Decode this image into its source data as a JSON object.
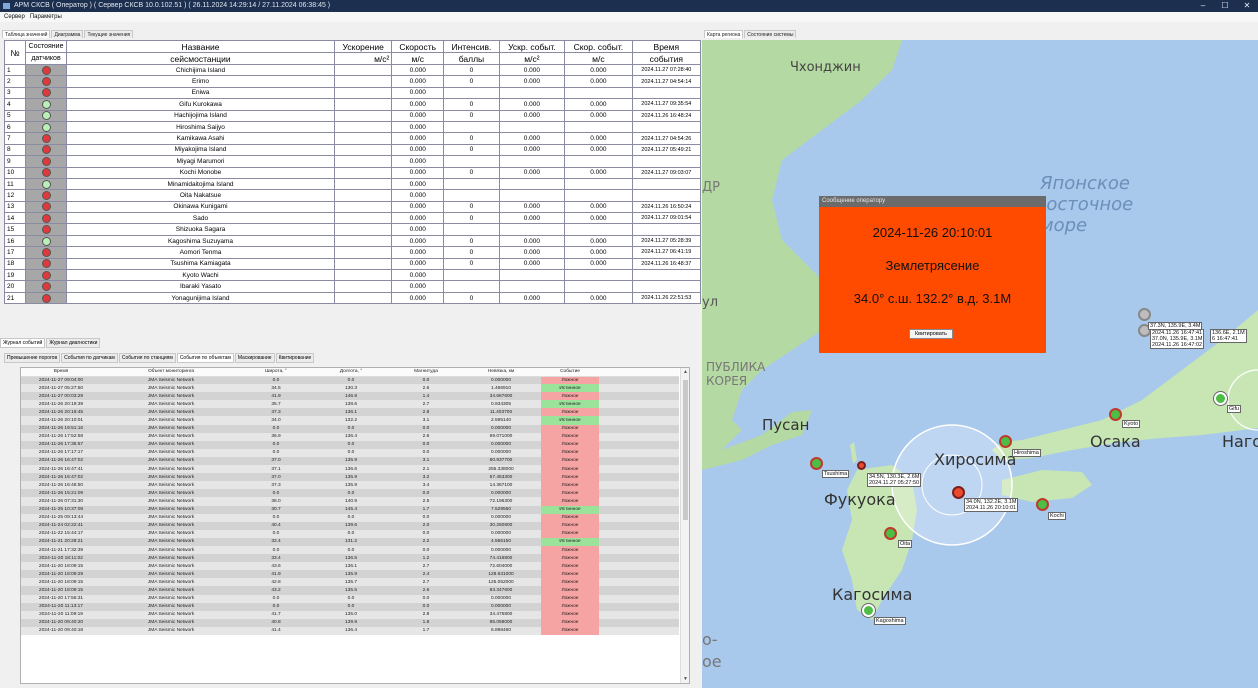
{
  "window": {
    "title": "АРМ СКСВ ( Оператор ) ( Сервер СКСВ 10.0.102.51 ) ( 26.11.2024 14:29:14 / 27.11.2024 06:38:45 )",
    "minimize": "–",
    "maximize": "☐",
    "close": "✕"
  },
  "menu": {
    "items": [
      "Сервер",
      "Параметры"
    ]
  },
  "left_tabs": [
    "Таблица значений",
    "Диаграмма",
    "Текущие значения"
  ],
  "stations_table": {
    "headers": {
      "num": "№",
      "state": [
        "Состояние",
        "датчиков"
      ],
      "name": [
        "Название",
        "сейсмостанции"
      ],
      "accel": [
        "Ускорение",
        "м/с²"
      ],
      "speed": [
        "Скорость",
        "м/с"
      ],
      "intensity": [
        "Интенсив.",
        "баллы"
      ],
      "ev_accel": [
        "Ускр. событ.",
        "м/с²"
      ],
      "ev_speed": [
        "Скор. событ.",
        "м/с"
      ],
      "ev_time": [
        "Время",
        "события"
      ]
    },
    "rows": [
      {
        "n": "1",
        "state": "red",
        "name": "Chichijima Island",
        "accel": "",
        "speed": "0.000",
        "int": "0",
        "ea": "0.000",
        "es": "0.000",
        "t": "2024.11.27 07:28:40"
      },
      {
        "n": "2",
        "state": "red",
        "name": "Erimo",
        "accel": "",
        "speed": "0.000",
        "int": "0",
        "ea": "0.000",
        "es": "0.000",
        "t": "2024.11.27 04:54:14"
      },
      {
        "n": "3",
        "state": "red",
        "name": "Eniwa",
        "accel": "",
        "speed": "0.000",
        "int": "",
        "ea": "",
        "es": "",
        "t": ""
      },
      {
        "n": "4",
        "state": "green",
        "name": "Gifu Kurokawa",
        "accel": "",
        "speed": "0.000",
        "int": "0",
        "ea": "0.000",
        "es": "0.000",
        "t": "2024.11.27 09:35:54"
      },
      {
        "n": "5",
        "state": "green",
        "name": "Hachijojima Island",
        "accel": "",
        "speed": "0.000",
        "int": "0",
        "ea": "0.000",
        "es": "0.000",
        "t": "2024.11.26 16:48:24"
      },
      {
        "n": "6",
        "state": "green",
        "name": "Hiroshima Saijyo",
        "accel": "",
        "speed": "0.000",
        "int": "",
        "ea": "",
        "es": "",
        "t": ""
      },
      {
        "n": "7",
        "state": "red",
        "name": "Kamikawa Asahi",
        "accel": "",
        "speed": "0.000",
        "int": "0",
        "ea": "0.000",
        "es": "0.000",
        "t": "2024.11.27 04:54:26"
      },
      {
        "n": "8",
        "state": "red",
        "name": "Miyakojima Island",
        "accel": "",
        "speed": "0.000",
        "int": "0",
        "ea": "0.000",
        "es": "0.000",
        "t": "2024.11.27 05:49:21"
      },
      {
        "n": "9",
        "state": "red",
        "name": "Miyagi Marumori",
        "accel": "",
        "speed": "0.000",
        "int": "",
        "ea": "",
        "es": "",
        "t": ""
      },
      {
        "n": "10",
        "state": "red",
        "name": "Kochi Monobe",
        "accel": "",
        "speed": "0.000",
        "int": "0",
        "ea": "0.000",
        "es": "0.000",
        "t": "2024.11.27 09:03:07"
      },
      {
        "n": "11",
        "state": "green",
        "name": "Minamidaitojima Island",
        "accel": "",
        "speed": "0.000",
        "int": "",
        "ea": "",
        "es": "",
        "t": ""
      },
      {
        "n": "12",
        "state": "red",
        "name": "Oita Nakatsue",
        "accel": "",
        "speed": "0.000",
        "int": "",
        "ea": "",
        "es": "",
        "t": ""
      },
      {
        "n": "13",
        "state": "red",
        "name": "Okinawa Kunigami",
        "accel": "",
        "speed": "0.000",
        "int": "0",
        "ea": "0.000",
        "es": "0.000",
        "t": "2024.11.26 16:50:24"
      },
      {
        "n": "14",
        "state": "red",
        "name": "Sado",
        "accel": "",
        "speed": "0.000",
        "int": "0",
        "ea": "0.000",
        "es": "0.000",
        "t": "2024.11.27 09:01:54"
      },
      {
        "n": "15",
        "state": "red",
        "name": "Shizuoka Sagara",
        "accel": "",
        "speed": "0.000",
        "int": "",
        "ea": "",
        "es": "",
        "t": ""
      },
      {
        "n": "16",
        "state": "green",
        "name": "Kagoshima Suzuyama",
        "accel": "",
        "speed": "0.000",
        "int": "0",
        "ea": "0.000",
        "es": "0.000",
        "t": "2024.11.27 05:28:39"
      },
      {
        "n": "17",
        "state": "red",
        "name": "Aomori Tenma",
        "accel": "",
        "speed": "0.000",
        "int": "0",
        "ea": "0.000",
        "es": "0.000",
        "t": "2024.11.27 06:41:19"
      },
      {
        "n": "18",
        "state": "red",
        "name": "Tsushima Kamiagata",
        "accel": "",
        "speed": "0.000",
        "int": "0",
        "ea": "0.000",
        "es": "0.000",
        "t": "2024.11.26 16:48:37"
      },
      {
        "n": "19",
        "state": "red",
        "name": "Kyoto Wachi",
        "accel": "",
        "speed": "0.000",
        "int": "",
        "ea": "",
        "es": "",
        "t": ""
      },
      {
        "n": "20",
        "state": "red",
        "name": "Ibaraki Yasato",
        "accel": "",
        "speed": "0.000",
        "int": "",
        "ea": "",
        "es": "",
        "t": ""
      },
      {
        "n": "21",
        "state": "red",
        "name": "Yonagunijima Island",
        "accel": "",
        "speed": "0.000",
        "int": "0",
        "ea": "0.000",
        "es": "0.000",
        "t": "2024.11.26 22:51:53"
      }
    ]
  },
  "log_tabs": [
    "Журнал событий",
    "Журнал диагностики"
  ],
  "event_tabs": [
    "Превышение порогов",
    "События по датчикам",
    "События по станциям",
    "События по объектам",
    "Маскирование",
    "Квитирование"
  ],
  "events_table": {
    "headers": [
      "Время",
      "Объект мониторинга",
      "Широта, °",
      "Долгота, °",
      "Магнитуда",
      "Невязка, км",
      "Событие"
    ],
    "rows": [
      [
        "2024-11-27 09:04:00",
        "JMA Seismic Network",
        "0.0",
        "0.0",
        "0.0",
        "0.000000",
        "Ложное"
      ],
      [
        "2024-11-27 05:27:50",
        "JMA Seismic Network",
        "34.5",
        "130.3",
        "2.6",
        "1.466910",
        "Истинное"
      ],
      [
        "2024-11-27 00:03:29",
        "JMA Seismic Network",
        "41.9",
        "146.8",
        "1.4",
        "34.667600",
        "Ложное"
      ],
      [
        "2024-11-26 20:19:39",
        "JMA Seismic Network",
        "35.7",
        "138.6",
        "2.7",
        "0.934305",
        "Истинное"
      ],
      [
        "2024-11-26 20:19:45",
        "JMA Seismic Network",
        "37.3",
        "136.1",
        "2.8",
        "11.403700",
        "Ложное"
      ],
      [
        "2024-11-26 20:10:01",
        "JMA Seismic Network",
        "34.0",
        "132.2",
        "3.1",
        "2.595140",
        "Истинное"
      ],
      [
        "2024-11-26 19:51:16",
        "JMA Seismic Network",
        "0.0",
        "0.0",
        "0.0",
        "0.000000",
        "Ложное"
      ],
      [
        "2024-11-26 17:52:58",
        "JMA Seismic Network",
        "36.9",
        "136.4",
        "2.6",
        "69.071000",
        "Ложное"
      ],
      [
        "2024-11-26 17:35:57",
        "JMA Seismic Network",
        "0.0",
        "0.0",
        "0.0",
        "0.000000",
        "Ложное"
      ],
      [
        "2024-11-26 17:17:17",
        "JMA Seismic Network",
        "0.0",
        "0.0",
        "0.0",
        "0.000000",
        "Ложное"
      ],
      [
        "2024-11-26 16:47:02",
        "JMA Seismic Network",
        "37.0",
        "135.9",
        "3.1",
        "60.937700",
        "Ложное"
      ],
      [
        "2024-11-26 16:47:41",
        "JMA Seismic Network",
        "37.1",
        "136.6",
        "2.1",
        "255.338000",
        "Ложное"
      ],
      [
        "2024-11-26 16:47:02",
        "JMA Seismic Network",
        "37.0",
        "135.9",
        "3.2",
        "57.453300",
        "Ложное"
      ],
      [
        "2024-11-26 16:46:50",
        "JMA Seismic Network",
        "37.3",
        "135.9",
        "3.4",
        "14.367100",
        "Ложное"
      ],
      [
        "2024-11-26 15:21:09",
        "JMA Seismic Network",
        "0.0",
        "0.0",
        "0.0",
        "0.000000",
        "Ложное"
      ],
      [
        "2024-11-26 07:31:30",
        "JMA Seismic Network",
        "38.0",
        "140.9",
        "2.5",
        "72.196300",
        "Ложное"
      ],
      [
        "2024-11-25 10:37:08",
        "JMA Seismic Network",
        "30.7",
        "145.4",
        "1.7",
        "7.529560",
        "Истинное"
      ],
      [
        "2024-11-25 09:13:44",
        "JMA Seismic Network",
        "0.0",
        "0.0",
        "0.0",
        "0.000000",
        "Ложное"
      ],
      [
        "2024-11-24 02:22:41",
        "JMA Seismic Network",
        "40.4",
        "139.6",
        "2.0",
        "30.250800",
        "Ложное"
      ],
      [
        "2024-11-22 15:44:17",
        "JMA Seismic Network",
        "0.0",
        "0.0",
        "0.0",
        "0.000000",
        "Ложное"
      ],
      [
        "2024-11-21 20:28:21",
        "JMA Seismic Network",
        "32.4",
        "131.2",
        "2.2",
        "4.566150",
        "Истинное"
      ],
      [
        "2024-11-21 17:32:39",
        "JMA Seismic Network",
        "0.0",
        "0.0",
        "0.0",
        "0.000000",
        "Ложное"
      ],
      [
        "2024-11-20 18:11:02",
        "JMA Seismic Network",
        "33.4",
        "136.5",
        "1.2",
        "74.416800",
        "Ложное"
      ],
      [
        "2024-11-20 18:09:15",
        "JMA Seismic Network",
        "43.6",
        "136.1",
        "2.7",
        "72.604000",
        "Ложное"
      ],
      [
        "2024-11-20 18:09:29",
        "JMA Seismic Network",
        "41.9",
        "135.9",
        "2.4",
        "128.631000",
        "Ложное"
      ],
      [
        "2024-11-20 18:09:15",
        "JMA Seismic Network",
        "42.8",
        "135.7",
        "2.7",
        "125.052000",
        "Ложное"
      ],
      [
        "2024-11-20 18:09:15",
        "JMA Seismic Network",
        "43.2",
        "135.5",
        "2.6",
        "83.347600",
        "Ложное"
      ],
      [
        "2024-11-20 17:55:31",
        "JMA Seismic Network",
        "0.0",
        "0.0",
        "0.0",
        "0.000000",
        "Ложное"
      ],
      [
        "2024-11-20 11:13:17",
        "JMA Seismic Network",
        "0.0",
        "0.0",
        "0.0",
        "0.000000",
        "Ложное"
      ],
      [
        "2024-11-20 11:09:19",
        "JMA Seismic Network",
        "41.7",
        "135.0",
        "2.8",
        "34.475800",
        "Ложное"
      ],
      [
        "2024-11-20 09:40:20",
        "JMA Seismic Network",
        "40.8",
        "139.9",
        "1.8",
        "65.058000",
        "Ложное"
      ],
      [
        "2024-11-20 09:40:18",
        "JMA Seismic Network",
        "41.4",
        "136.4",
        "1.7",
        "6.898460",
        "Ложное"
      ]
    ]
  },
  "right_tabs": [
    "Карта региона",
    "Состояние системы"
  ],
  "map": {
    "labels": {
      "chongjin": "Чхонджин",
      "sea_of_japan_1": "Японское",
      "sea_of_japan_2": "Восточное",
      "sea_of_japan_3": "море",
      "busan": "Пусан",
      "hiroshima": "Хиросима",
      "osaka": "Осака",
      "nagoya": "Наго",
      "fukuoka": "Фукуока",
      "kagoshima": "Кагосима",
      "republic_1": "ПУБЛИКА",
      "republic_2": "КОРЕЯ",
      "edge_dpr": "ДР",
      "edge_ul": "ул",
      "edge_o": "о-",
      "edge_oe": "ое"
    },
    "station_tags": {
      "tsushima": "Tsushima",
      "hiroshima": "Hiroshima",
      "kochi": "Kochi",
      "oita": "Oita",
      "kagoshima": "Kagoshima",
      "kyoto": "Kyoto",
      "gifu": "Gifu"
    },
    "event_tags": {
      "tsushima_event": [
        "34.5N, 130.3E, 2.6M",
        "2024.11.27 05:27:50"
      ],
      "main_event": [
        "34.0N, 132.2E, 3.1M",
        "2024.11.26 20:10:01"
      ],
      "north_event_a": [
        "37.3N, 135.9E, 3.4M"
      ],
      "north_event_b": [
        "2024.11.26 16:47:41",
        "37.0N, 135.9E, 3.1M",
        "2024.11.26 16:47:02"
      ],
      "north_event_c": [
        "136.6E, 2.1M",
        "6 16:47:41"
      ]
    }
  },
  "popup": {
    "title": "Сообщение оператору",
    "datetime": "2024-11-26 20:10:01",
    "event": "Землетрясение",
    "location": "34.0° с.ш. 132.2° в.д. 3.1М",
    "ack_button": "Квитировать"
  },
  "colors": {
    "red_led": "#e0393b",
    "green_led": "#b8f0b8",
    "popup_bg": "#ff4b00",
    "false_event": "#f6a3a3",
    "true_event": "#9be39b"
  }
}
